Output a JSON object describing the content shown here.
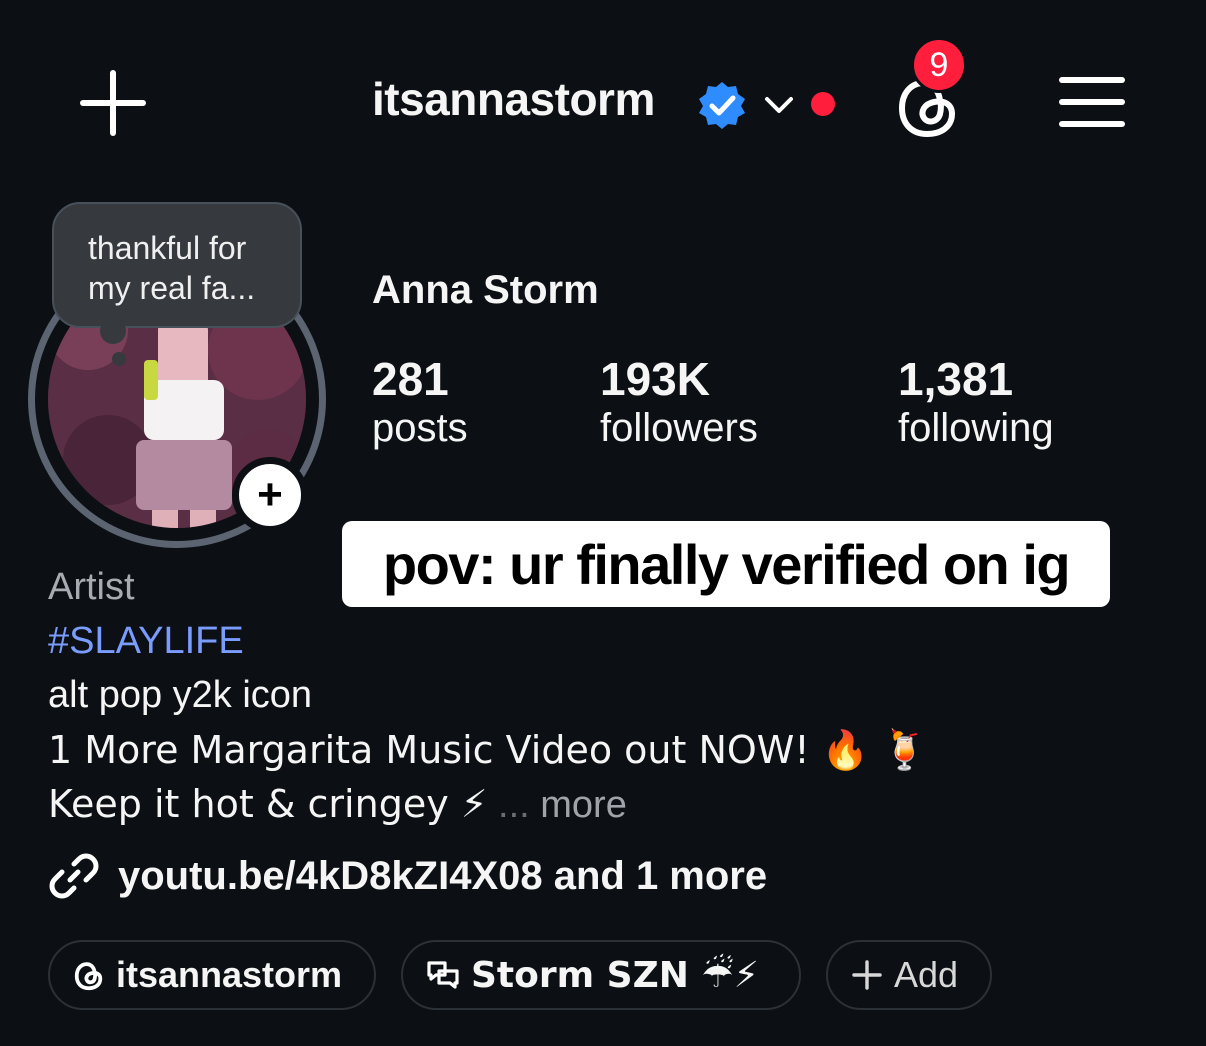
{
  "header": {
    "username": "itsannastorm",
    "notification_count": "9",
    "verified_icon": "verified-badge-icon",
    "accent_blue": "#2f8cff",
    "alert_red": "#ff1f3d"
  },
  "profile": {
    "note_text": "thankful for\nmy real fa...",
    "full_name": "Anna Storm",
    "stats": [
      {
        "value": "281",
        "label": "posts"
      },
      {
        "value": "193K",
        "label": "followers"
      },
      {
        "value": "1,381",
        "label": "following"
      }
    ]
  },
  "overlay_caption": "pov: ur finally verified on ig",
  "bio": {
    "category": "Artist",
    "hashtag": "#SLAYLIFE",
    "line1": "alt pop y2k icon",
    "line2": "1 More Margarita Music Video out NOW! 🔥 🍹",
    "line3": "Keep it hot & cringey ⚡",
    "ellipsis": "...",
    "more": "more"
  },
  "link": {
    "text": "youtu.be/4kD8kZI4X08 and 1 more"
  },
  "chips": [
    {
      "label": "itsannastorm",
      "icon": "threads-icon"
    },
    {
      "label": "Storm SZN ☔⚡",
      "icon": "chat-icon"
    },
    {
      "label": "Add",
      "icon": "plus-icon"
    }
  ]
}
